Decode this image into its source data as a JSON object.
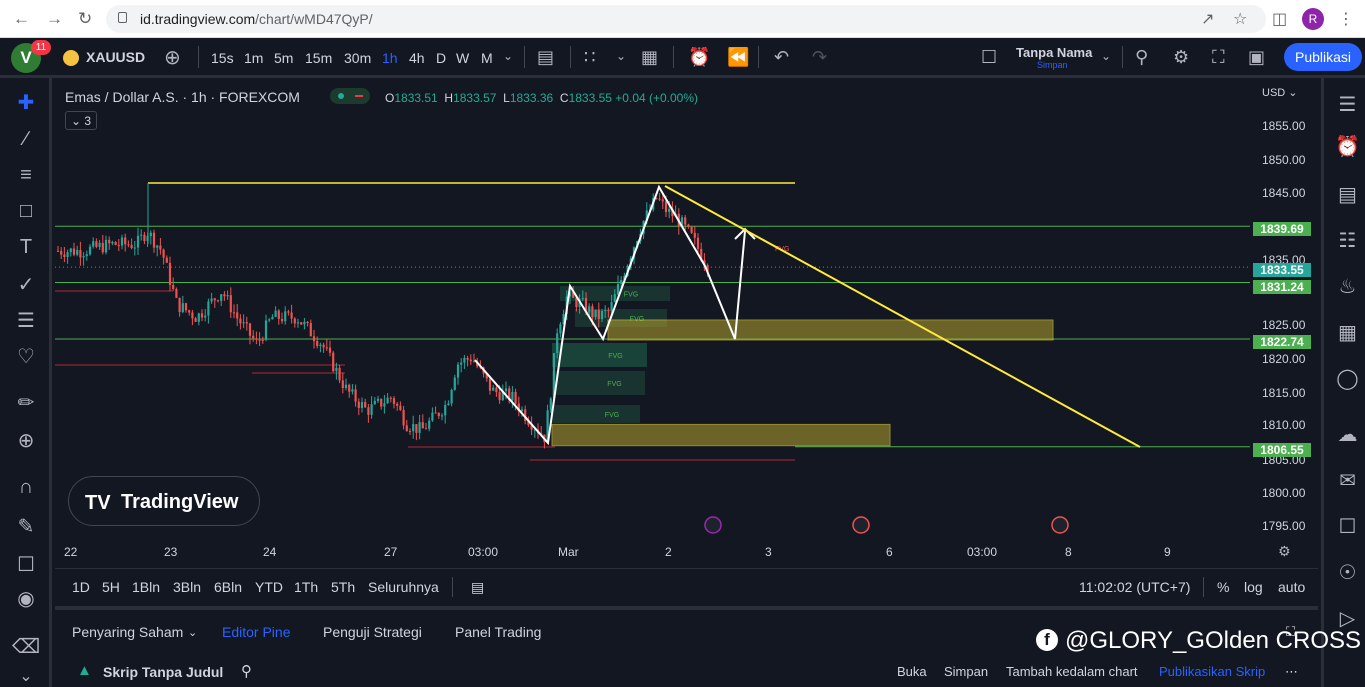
{
  "browser": {
    "url_domain": "id.tradingview.com",
    "url_path": "/chart/wMD47QyP/",
    "profile_initial": "R"
  },
  "topbar": {
    "logo": "V",
    "notifications": "11",
    "symbol": "XAUUSD",
    "timeframes": [
      "15s",
      "1m",
      "5m",
      "15m",
      "30m",
      "1h",
      "4h",
      "D",
      "W",
      "M"
    ],
    "active_timeframe": "1h",
    "layout_name": "Tanpa Nama",
    "layout_status": "Simpan",
    "publish_label": "Publikasi"
  },
  "legend": {
    "title": "Emas / Dollar A.S. · 1h · FOREXCOM",
    "open_label": "O",
    "open": "1833.51",
    "high_label": "H",
    "high": "1833.57",
    "low_label": "L",
    "low": "1833.36",
    "close_label": "C",
    "close": "1833.55",
    "change": "+0.04 (+0.00%)",
    "indicator_count": "3"
  },
  "price_axis": {
    "currency": "USD",
    "ticks": [
      "1855.00",
      "1850.00",
      "1845.00",
      "1835.00",
      "1825.00",
      "1820.00",
      "1815.00",
      "1810.00",
      "1805.00",
      "1800.00",
      "1795.00"
    ],
    "labels": [
      {
        "text": "1839.69",
        "color": "#4caf50"
      },
      {
        "text": "1833.55",
        "color": "#26a69a"
      },
      {
        "text": "1831.24",
        "color": "#4caf50"
      },
      {
        "text": "1822.74",
        "color": "#4caf50"
      },
      {
        "text": "1806.55",
        "color": "#4caf50"
      }
    ]
  },
  "time_axis": {
    "labels": [
      "22",
      "23",
      "24",
      "27",
      "03:00",
      "Mar",
      "2",
      "3",
      "6",
      "03:00",
      "8",
      "9"
    ]
  },
  "chart_data": {
    "type": "candlestick",
    "colors": {
      "up": "#26a69a",
      "down": "#ef5350",
      "trend": "#ffeb3b",
      "level": "#4caf50",
      "zone": "#ffeb3b"
    },
    "ylim": [
      1792,
      1859
    ],
    "fvg_label": "FVG",
    "zones": [
      [
        1822.6,
        1825.6
      ],
      [
        1806.7,
        1809.9
      ]
    ],
    "levels": [
      1839.69,
      1831.24,
      1822.74,
      1806.55
    ],
    "resistance": 1846.2,
    "current_price": 1833.55
  },
  "ranges": {
    "items": [
      "1D",
      "5H",
      "1Bln",
      "3Bln",
      "6Bln",
      "YTD",
      "1Th",
      "5Th",
      "Seluruhnya"
    ],
    "clock": "11:02:02 (UTC+7)",
    "pct": "%",
    "log": "log",
    "auto": "auto"
  },
  "panels": {
    "tabs": [
      "Penyaring Saham",
      "Editor Pine",
      "Penguji Strategi",
      "Panel Trading"
    ],
    "active_tab": "Editor Pine",
    "script_name": "Skrip Tanpa Judul",
    "actions": [
      "Buka",
      "Simpan",
      "Tambah kedalam chart",
      "Publikasikan Skrip"
    ]
  },
  "brand": {
    "tv_logo_text": "TradingView"
  },
  "watermark": {
    "text": "@GLORY_GOlden CROSS"
  }
}
